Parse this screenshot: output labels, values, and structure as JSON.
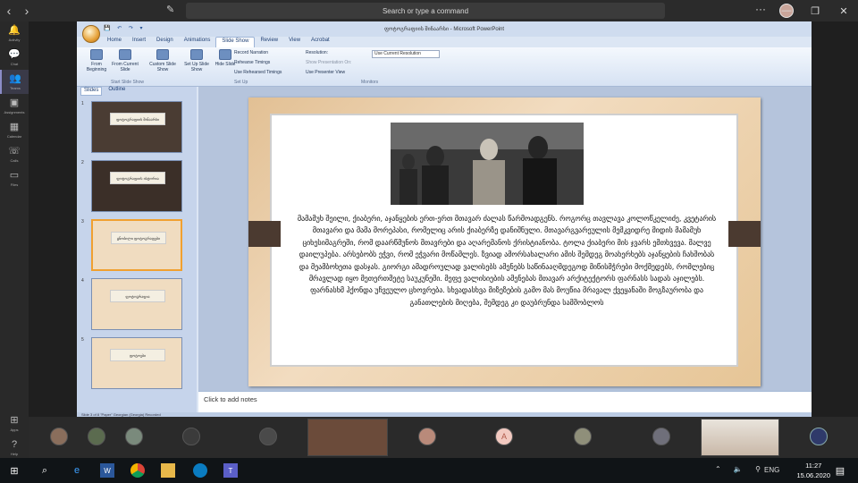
{
  "top": {
    "search_placeholder": "Search or type a command"
  },
  "rail": [
    {
      "icon": "bell-icon",
      "label": "Activity"
    },
    {
      "icon": "chat-icon",
      "label": "Chat"
    },
    {
      "icon": "teams-icon",
      "label": "Teams",
      "active": true
    },
    {
      "icon": "assignments-icon",
      "label": "Assignments"
    },
    {
      "icon": "calendar-icon",
      "label": "Calendar"
    },
    {
      "icon": "calls-icon",
      "label": "Calls"
    },
    {
      "icon": "files-icon",
      "label": "Files"
    }
  ],
  "rail_bottom": [
    {
      "icon": "apps-icon",
      "label": "Apps"
    },
    {
      "icon": "help-icon",
      "label": "Help"
    }
  ],
  "ppt": {
    "window_title": "ფოტოგრაფიის შინაარსი - Microsoft PowerPoint",
    "tabs": [
      "Home",
      "Insert",
      "Design",
      "Animations",
      "Slide Show",
      "Review",
      "View",
      "Acrobat"
    ],
    "active_tab": "Slide Show",
    "ribbon": {
      "from_beginning": "From Beginning",
      "from_current": "From Current Slide",
      "custom_show": "Custom Slide Show",
      "group_start": "Start Slide Show",
      "setup_show": "Set Up Slide Show",
      "hide_slide": "Hide Slide",
      "record_narration": "Record Narration",
      "rehearse": "Rehearse Timings",
      "use_rehearsed": "Use Rehearsed Timings",
      "group_setup": "Set Up",
      "resolution_label": "Resolution:",
      "resolution_value": "Use Current Resolution",
      "show_on": "Show Presentation On:",
      "presenter_view": "Use Presenter View",
      "group_monitors": "Monitors"
    },
    "left_tabs": [
      "Slides",
      "Outline"
    ],
    "thumbs": [
      {
        "num": "1",
        "title": "ფოტოგრაფიის შინაარსი"
      },
      {
        "num": "2",
        "title": "ფოტოგრაფიის ისტორია"
      },
      {
        "num": "3",
        "title": "ცნობილი ფოტოგრაფები"
      },
      {
        "num": "4",
        "title": "ფოტოგრაფია"
      },
      {
        "num": "5",
        "title": "ფოტოები"
      }
    ],
    "slide_body": "მამამუხ შეილი, ქიაბერი, აჯანყების ერთ-ერთ მთავარ ძალას წარმოადგენს. როგორც თავლავა კოლოწკელიძე, კვეტარის მთავარი და მამა მორეპასი, რომელიც არის ქიაბერზე დანიშნული. მთავარგვარეულის მემკვიდრე მიდის მამამუხ ციხესიმაგრეში, რომ დაარწმუნოს მთავრები და აღარემანოს ქრისტიანობა. ტოლა ქიაბერი მის ჯვარს ემთხვევა. მალვე დაილუპება. არსებობს ეჭვი, რომ ეჭვარი მოწამლეს. ზვიად ამორსახალარი ამის შემდეგ მოახერხებს აჯანყების ჩახშობას და მეამბოხეთა დასჯას. გიორგი ამადროულად ვალისებს ამენებს საწინააღმდეგოდ მიწისმჭრები მოქმედებს, რომლებიც მრავლად იყო მეთერთმეტე საუკუნეში. მეფე ვალისიების ამენებას მთავარ არქიტექტორს ფარნასს სადას აჯილებს. ფარნასხმ ჰქონდა უჩვეულო ცხოვრება. სხვადასხვა მიზეზების გამო მას მოუწია მრავალ ქვეყანაში მოგზაურობა და განათლების მიღება, შემდეგ კი დაუბრუნდა სამშობლოს",
    "notes_placeholder": "Click to add notes",
    "status": "Slide 3 of 8    \"Paper\"    Georgian (Georgia)    Recorded"
  },
  "taskbar": {
    "time": "11:27",
    "date": "15.06.2020",
    "lang": "ENG"
  },
  "participant_initial": "A"
}
